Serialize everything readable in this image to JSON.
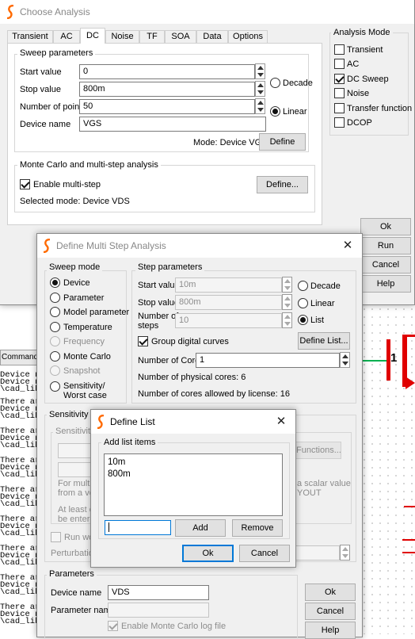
{
  "choose": {
    "title": "Choose Analysis",
    "tabs": [
      "Transient",
      "AC",
      "DC",
      "Noise",
      "TF",
      "SOA",
      "Data",
      "Options"
    ],
    "sweep": {
      "group_label": "Sweep parameters",
      "start_label": "Start value",
      "start_value": "0",
      "stop_label": "Stop value",
      "stop_value": "800m",
      "points_label": "Number of points",
      "points_value": "50",
      "device_label": "Device name",
      "device_value": "VGS",
      "decade": "Decade",
      "linear": "Linear",
      "mode": "Mode: Device VGS",
      "define": "Define"
    },
    "mc": {
      "group_label": "Monte Carlo and multi-step analysis",
      "enable": "Enable multi-step",
      "define": "Define...",
      "selected": "Selected mode: Device VDS"
    },
    "mode_group": "Analysis Mode",
    "modes": [
      "Transient",
      "AC",
      "DC Sweep",
      "Noise",
      "Transfer function",
      "DCOP"
    ],
    "buttons": {
      "ok": "Ok",
      "run": "Run",
      "cancel": "Cancel",
      "help": "Help"
    }
  },
  "command_tab": "Command Sh",
  "log_lines": [
    "Device nm",
    "Device nm",
    "\\cad_lib\\",
    "There are",
    "Device nm",
    "\\cad_lib\\"
  ],
  "schematic": {
    "label": "1"
  },
  "multi": {
    "title": "Define Multi Step Analysis",
    "sweep_mode_label": "Sweep mode",
    "modes": [
      "Device",
      "Parameter",
      "Model parameter",
      "Temperature",
      "Frequency",
      "Monte Carlo",
      "Snapshot",
      "Sensitivity/",
      "Worst case"
    ],
    "step_label": "Step parameters",
    "start_label": "Start value",
    "start_value": "10m",
    "stop_label": "Stop value",
    "stop_value": "800m",
    "steps_label_1": "Number of",
    "steps_label_2": "steps",
    "steps_value": "10",
    "decade": "Decade",
    "linear": "Linear",
    "list": "List",
    "group_digital": "Group digital curves",
    "define_list": "Define List...",
    "cores_label": "Number of Cores",
    "cores_value": "1",
    "physical": "Number of physical cores: 6",
    "allowed": "Number of cores allowed by license: 16",
    "sens_label": "Sensitivity pa",
    "sens_inner": "Sensitivity",
    "functions": "Functions...",
    "hint1": "For multi-s",
    "hint2": "from a vec",
    "hint3": "a scalar value",
    "hint4": "YOUT",
    "hint5": "At least on",
    "hint6": "be entered",
    "run_wors": "Run wors",
    "perturbation": "Perturbation",
    "params_label": "Parameters",
    "device_label": "Device name",
    "device_value": "VDS",
    "param_label": "Parameter name",
    "param_value": "",
    "enable_mc_log": "Enable Monte Carlo log file",
    "buttons": {
      "ok": "Ok",
      "cancel": "Cancel",
      "help": "Help"
    }
  },
  "deflist": {
    "title": "Define List",
    "group_label": "Add list items",
    "items": [
      "10m",
      "800m"
    ],
    "input_value": "",
    "add": "Add",
    "remove": "Remove",
    "ok": "Ok",
    "cancel": "Cancel"
  },
  "colors": {
    "accent": "#0078d7",
    "logo": "#ff6a00",
    "wire": "#00b050",
    "part": "#e00000"
  }
}
